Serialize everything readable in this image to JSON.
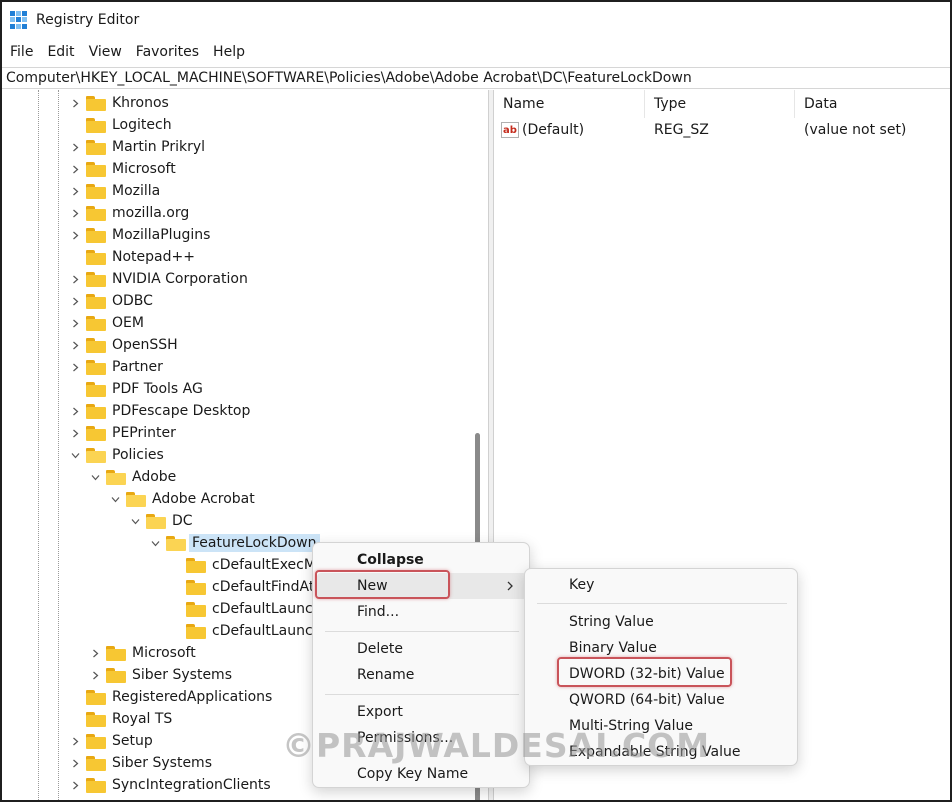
{
  "window": {
    "title": "Registry Editor"
  },
  "menu": [
    "File",
    "Edit",
    "View",
    "Favorites",
    "Help"
  ],
  "address": "Computer\\HKEY_LOCAL_MACHINE\\SOFTWARE\\Policies\\Adobe\\Adobe Acrobat\\DC\\FeatureLockDown",
  "tree": {
    "items": [
      {
        "label": "Khronos",
        "depth": 0,
        "expander": "collapsed"
      },
      {
        "label": "Logitech",
        "depth": 0,
        "expander": "none"
      },
      {
        "label": "Martin Prikryl",
        "depth": 0,
        "expander": "collapsed"
      },
      {
        "label": "Microsoft",
        "depth": 0,
        "expander": "collapsed"
      },
      {
        "label": "Mozilla",
        "depth": 0,
        "expander": "collapsed"
      },
      {
        "label": "mozilla.org",
        "depth": 0,
        "expander": "collapsed"
      },
      {
        "label": "MozillaPlugins",
        "depth": 0,
        "expander": "collapsed"
      },
      {
        "label": "Notepad++",
        "depth": 0,
        "expander": "none"
      },
      {
        "label": "NVIDIA Corporation",
        "depth": 0,
        "expander": "collapsed"
      },
      {
        "label": "ODBC",
        "depth": 0,
        "expander": "collapsed"
      },
      {
        "label": "OEM",
        "depth": 0,
        "expander": "collapsed"
      },
      {
        "label": "OpenSSH",
        "depth": 0,
        "expander": "collapsed"
      },
      {
        "label": "Partner",
        "depth": 0,
        "expander": "collapsed"
      },
      {
        "label": "PDF Tools AG",
        "depth": 0,
        "expander": "none"
      },
      {
        "label": "PDFescape Desktop",
        "depth": 0,
        "expander": "collapsed"
      },
      {
        "label": "PEPrinter",
        "depth": 0,
        "expander": "collapsed"
      },
      {
        "label": "Policies",
        "depth": 0,
        "expander": "expanded"
      },
      {
        "label": "Adobe",
        "depth": 1,
        "expander": "expanded"
      },
      {
        "label": "Adobe Acrobat",
        "depth": 2,
        "expander": "expanded"
      },
      {
        "label": "DC",
        "depth": 3,
        "expander": "expanded"
      },
      {
        "label": "FeatureLockDown",
        "depth": 4,
        "expander": "expanded",
        "selected": true
      },
      {
        "label": "cDefaultExecMenuItems",
        "depth": 5,
        "expander": "none"
      },
      {
        "label": "cDefaultFindAttachmentPerms",
        "depth": 5,
        "expander": "none"
      },
      {
        "label": "cDefaultLaunchAttachmentPerms",
        "depth": 5,
        "expander": "none"
      },
      {
        "label": "cDefaultLaunchURLPerms",
        "depth": 5,
        "expander": "none"
      },
      {
        "label": "Microsoft",
        "depth": 1,
        "expander": "collapsed"
      },
      {
        "label": "Siber Systems",
        "depth": 1,
        "expander": "collapsed"
      },
      {
        "label": "RegisteredApplications",
        "depth": 0,
        "expander": "none"
      },
      {
        "label": "Royal TS",
        "depth": 0,
        "expander": "none"
      },
      {
        "label": "Setup",
        "depth": 0,
        "expander": "collapsed"
      },
      {
        "label": "Siber Systems",
        "depth": 0,
        "expander": "collapsed"
      },
      {
        "label": "SyncIntegrationClients",
        "depth": 0,
        "expander": "collapsed"
      }
    ]
  },
  "list": {
    "columns": [
      "Name",
      "Type",
      "Data"
    ],
    "rows": [
      {
        "icon": "ab",
        "name": "(Default)",
        "type": "REG_SZ",
        "data": "(value not set)"
      }
    ]
  },
  "context_menu": {
    "items": [
      "Collapse",
      "New",
      "Find...",
      "Delete",
      "Rename",
      "Export",
      "Permissions...",
      "Copy Key Name"
    ]
  },
  "new_submenu": {
    "items": [
      "Key",
      "String Value",
      "Binary Value",
      "DWORD (32-bit) Value",
      "QWORD (64-bit) Value",
      "Multi-String Value",
      "Expandable String Value"
    ]
  },
  "watermark": "©PRAJWALDESAI.COM",
  "colors": {
    "selection": "#cce4f7",
    "highlight_box": "#c9545a",
    "folder": "#f7c733"
  }
}
